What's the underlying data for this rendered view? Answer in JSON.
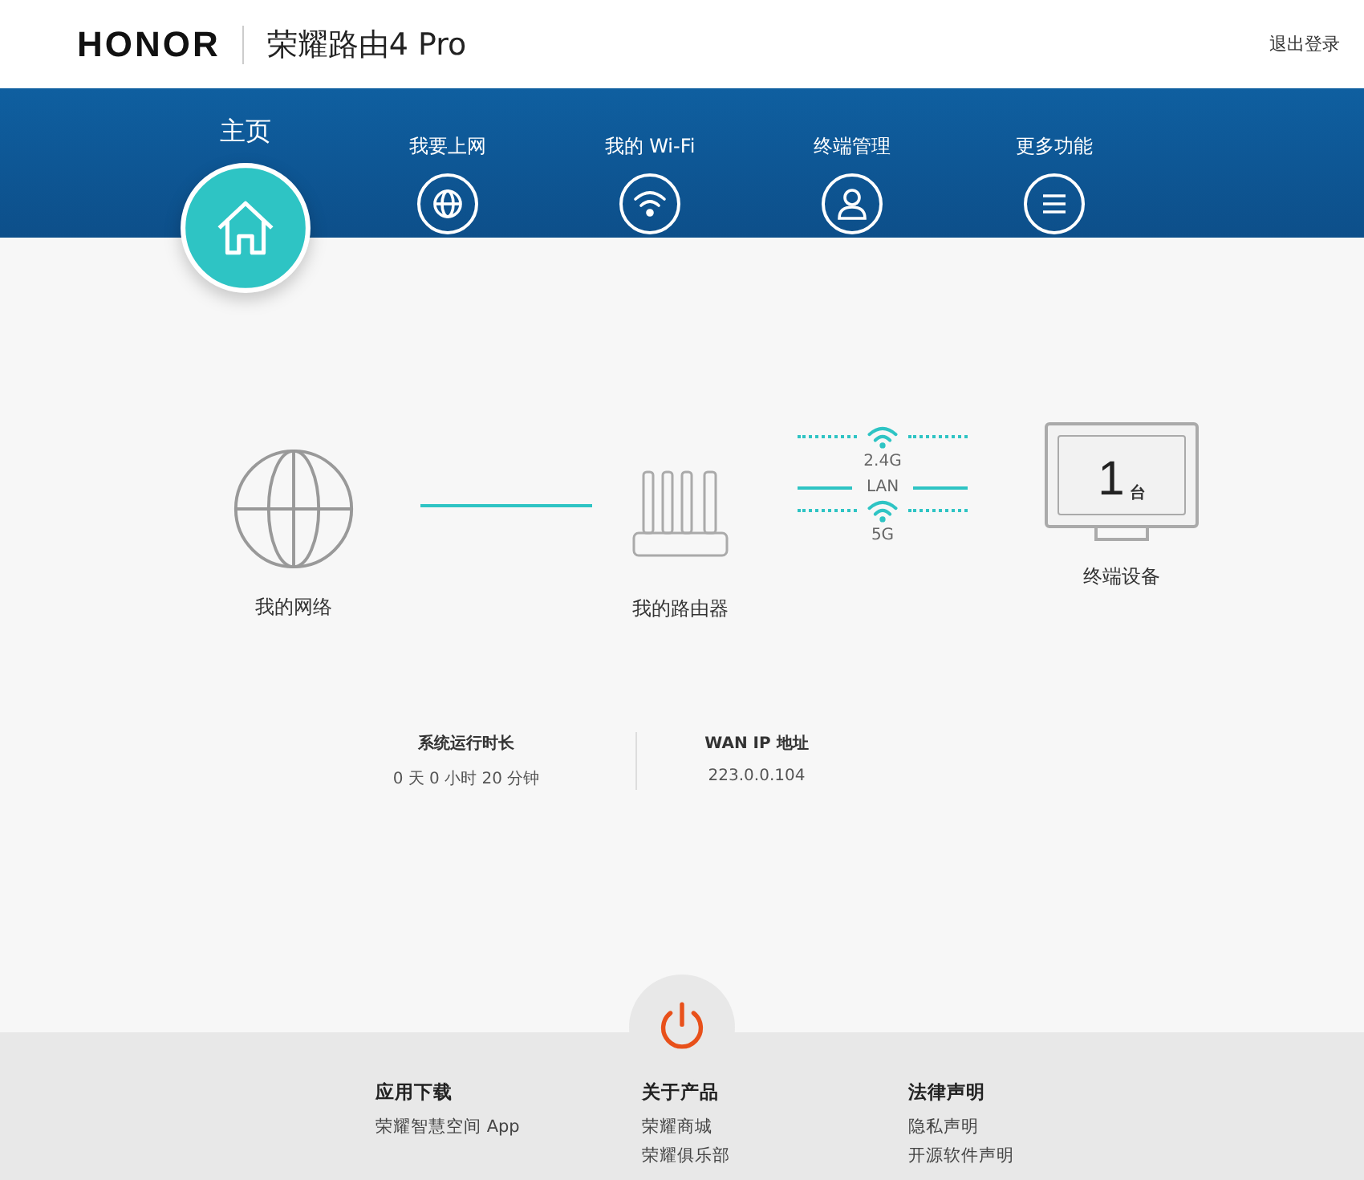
{
  "header": {
    "brand": "HONOR",
    "product": "荣耀路由4 Pro",
    "logout": "退出登录"
  },
  "nav": [
    {
      "label": "主页",
      "kind": "home",
      "selected": true
    },
    {
      "label": "我要上网",
      "kind": "globe",
      "selected": false
    },
    {
      "label": "我的 Wi-Fi",
      "kind": "wifi",
      "selected": false
    },
    {
      "label": "终端管理",
      "kind": "user",
      "selected": false
    },
    {
      "label": "更多功能",
      "kind": "menu",
      "selected": false
    }
  ],
  "topology": {
    "network": "我的网络",
    "router": "我的路由器",
    "band_24": "2.4G",
    "lan": "LAN",
    "band_5": "5G",
    "device_count": "1",
    "device_unit": "台",
    "devices": "终端设备"
  },
  "stats": [
    {
      "label": "系统运行时长",
      "value": "0 天 0 小时 20 分钟"
    },
    {
      "label": "WAN IP 地址",
      "value": "223.0.0.104"
    }
  ],
  "footer": [
    {
      "title": "应用下载",
      "links": [
        "荣耀智慧空间 App"
      ]
    },
    {
      "title": "关于产品",
      "links": [
        "荣耀商城",
        "荣耀俱乐部"
      ]
    },
    {
      "title": "法律声明",
      "links": [
        "隐私声明",
        "开源软件声明"
      ]
    }
  ]
}
